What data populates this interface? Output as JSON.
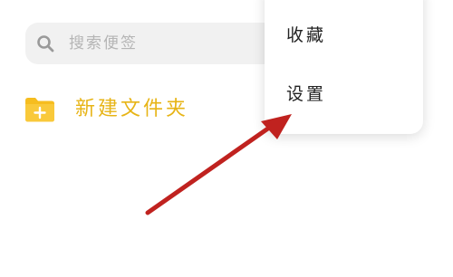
{
  "search": {
    "placeholder": "搜索便签",
    "icon": "search-icon"
  },
  "folder": {
    "new_label": "新建文件夹",
    "icon": "folder-plus-icon",
    "color": "#e7b416"
  },
  "menu": {
    "items": [
      {
        "label": "收藏"
      },
      {
        "label": "设置"
      }
    ]
  },
  "annotation": {
    "icon": "arrow-icon",
    "color": "#c0221f"
  }
}
